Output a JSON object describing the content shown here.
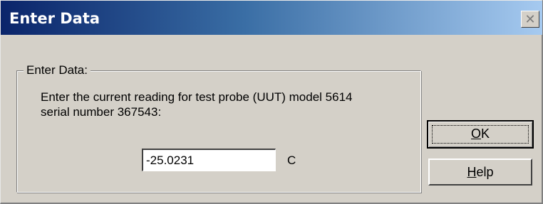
{
  "window": {
    "title": "Enter Data",
    "close_glyph": "✕"
  },
  "group": {
    "label": "Enter Data:",
    "prompt_line1": "Enter the current reading for test probe (UUT) model 5614",
    "prompt_line2": "serial number 367543:"
  },
  "input": {
    "value": "-25.0231",
    "unit": "C"
  },
  "buttons": {
    "ok": {
      "mnemonic": "O",
      "rest": "K"
    },
    "help": {
      "mnemonic": "H",
      "rest": "elp"
    }
  },
  "colors": {
    "titlebar_start": "#0a246a",
    "titlebar_end": "#a6caf0",
    "face": "#d4d0c8"
  }
}
